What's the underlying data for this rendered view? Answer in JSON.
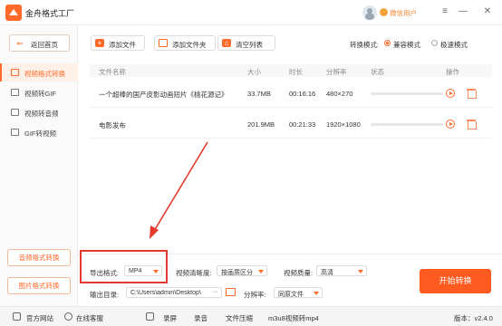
{
  "app": {
    "title": "金舟格式工厂",
    "user_name": "微信用户"
  },
  "sidebar": {
    "back_label": "返回首页",
    "items": [
      {
        "label": "视频格式转换",
        "active": true
      },
      {
        "label": "视频转GIF",
        "active": false
      },
      {
        "label": "视频转音频",
        "active": false
      },
      {
        "label": "GIF转视频",
        "active": false
      }
    ],
    "audio_convert_label": "音频格式转换",
    "image_convert_label": "图片格式转换"
  },
  "toolbar": {
    "add_file": "添加文件",
    "add_folder": "添加文件夹",
    "clear_list": "清空列表",
    "mode_label": "转换模式:",
    "mode_compatible": "兼容模式",
    "mode_fast": "极速模式",
    "selected_mode": "兼容模式"
  },
  "table": {
    "headers": [
      "文件名称",
      "大小",
      "时长",
      "分辨率",
      "状态",
      "操作"
    ],
    "rows": [
      {
        "name": "一个超棒的国产皮影动画短片《桃花源记》",
        "size": "33.7MB",
        "duration": "00:16:16",
        "resolution": "480×270",
        "progress": 0
      },
      {
        "name": "电影发布",
        "size": "201.9MB",
        "duration": "00:21:33",
        "resolution": "1920×1080",
        "progress": 0
      }
    ]
  },
  "settings": {
    "export_format_label": "导出格式:",
    "export_format_value": "MP4",
    "definition_label": "视频清晰度:",
    "definition_value": "按画质区分",
    "quality_label": "视频质量:",
    "quality_value": "高清",
    "output_dir_label": "输出目录:",
    "output_dir_value": "C:\\Users\\admin\\Desktop\\",
    "output_dir_button": "···",
    "resolution_label": "分辨率:",
    "resolution_value": "同原文件",
    "start_button": "开始转换"
  },
  "statusbar": {
    "website": "官方网站",
    "support": "在线客服",
    "record_screen": "录屏",
    "record_audio": "录音",
    "compress": "文件压缩",
    "m3u8": "m3u8视频转mp4",
    "version": "版本：v2.4.0"
  },
  "colors": {
    "accent": "#ff6a2a",
    "annotation_red": "#e23b2e"
  }
}
